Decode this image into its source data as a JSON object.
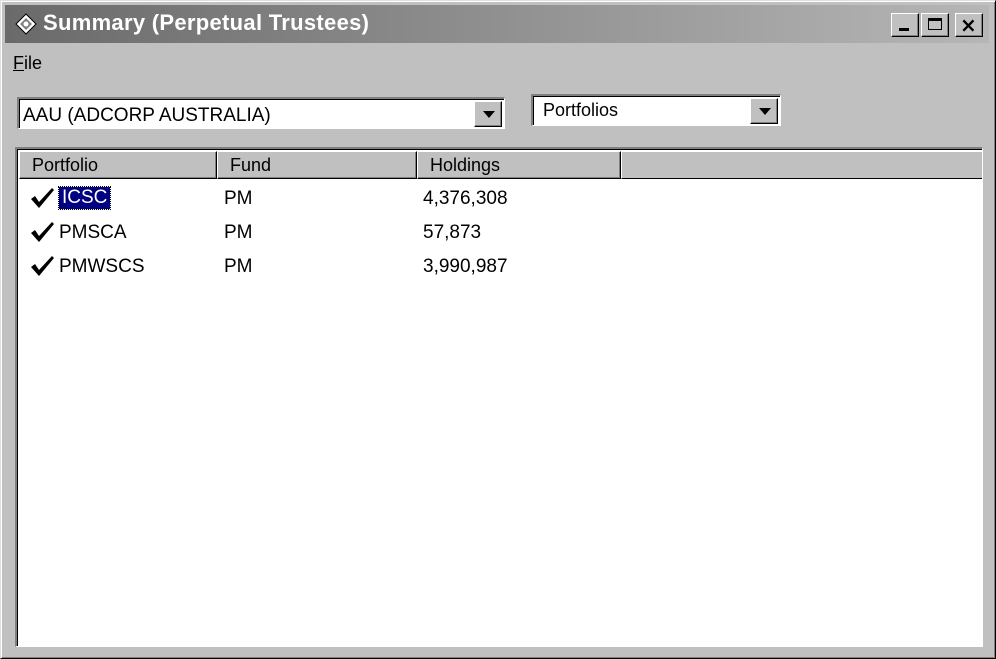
{
  "window": {
    "title": "Summary (Perpetual Trustees)",
    "caption_buttons": [
      "minimize",
      "maximize",
      "close"
    ]
  },
  "menu": {
    "items": [
      {
        "label": "File",
        "mnemonic": "F"
      }
    ]
  },
  "client_select": {
    "value": "AAU (ADCORP AUSTRALIA)"
  },
  "view_select": {
    "value": "Portfolios"
  },
  "list": {
    "columns": [
      {
        "label": "Portfolio"
      },
      {
        "label": "Fund"
      },
      {
        "label": "Holdings"
      }
    ],
    "rows": [
      {
        "portfolio": "ICSC",
        "fund": "PM",
        "holdings": "4,376,308",
        "checked": true,
        "selected": true
      },
      {
        "portfolio": "PMSCA",
        "fund": "PM",
        "holdings": "57,873",
        "checked": true,
        "selected": false
      },
      {
        "portfolio": "PMWSCS",
        "fund": "PM",
        "holdings": "3,990,987",
        "checked": true,
        "selected": false
      }
    ]
  },
  "colors": {
    "title_bar_start": "#6a6a6a",
    "title_bar_end": "#b6b6b6",
    "face": "#c0c0c0",
    "selection": "#000080",
    "check": "#000000"
  },
  "icons": {
    "app": "app-icon",
    "check": "checkmark-icon",
    "dropdown": "chevron-down-icon"
  }
}
